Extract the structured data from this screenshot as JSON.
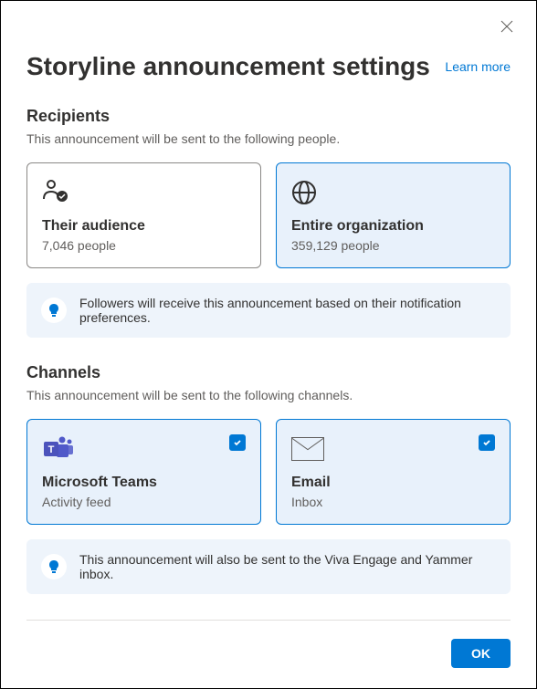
{
  "dialog": {
    "title": "Storyline announcement settings",
    "learnMore": "Learn more"
  },
  "recipients": {
    "heading": "Recipients",
    "description": "This announcement will be sent to the following people.",
    "options": [
      {
        "title": "Their audience",
        "subtitle": "7,046 people",
        "selected": false
      },
      {
        "title": "Entire organization",
        "subtitle": "359,129 people",
        "selected": true
      }
    ],
    "note": "Followers will receive this announcement based on their notification preferences."
  },
  "channels": {
    "heading": "Channels",
    "description": "This announcement will be sent to the following channels.",
    "options": [
      {
        "title": "Microsoft Teams",
        "subtitle": "Activity feed",
        "checked": true
      },
      {
        "title": "Email",
        "subtitle": "Inbox",
        "checked": true
      }
    ],
    "note": "This announcement will also be sent to the Viva Engage and Yammer inbox."
  },
  "footer": {
    "ok": "OK"
  }
}
